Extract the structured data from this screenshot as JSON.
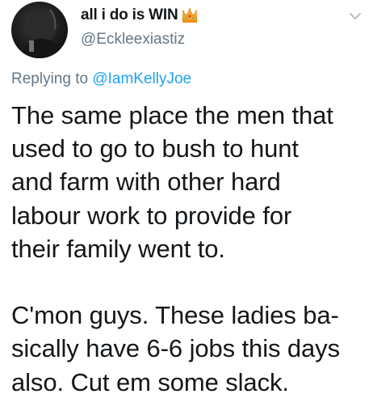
{
  "tweet": {
    "author": {
      "display_name": "all i do is WIN",
      "handle": "@Eckleexiastiz",
      "badge_icon": "crown-icon",
      "avatar_icon": "profile-photo"
    },
    "menu_icon": "chevron-down-icon",
    "reply_prefix": "Replying to ",
    "reply_mention": "@IamKellyJoe",
    "body_lines": [
      "The same place the men that",
      "used to go to bush to hunt",
      "and farm with other hard",
      "labour work to provide for",
      "their family went to.",
      "",
      "C'mon guys. These ladies ba-",
      "sically have 6-6 jobs this days",
      "also.  Cut em some slack."
    ]
  },
  "colors": {
    "text": "#14171a",
    "secondary": "#657786",
    "link": "#1da1f2",
    "crown": "#f5a623"
  }
}
